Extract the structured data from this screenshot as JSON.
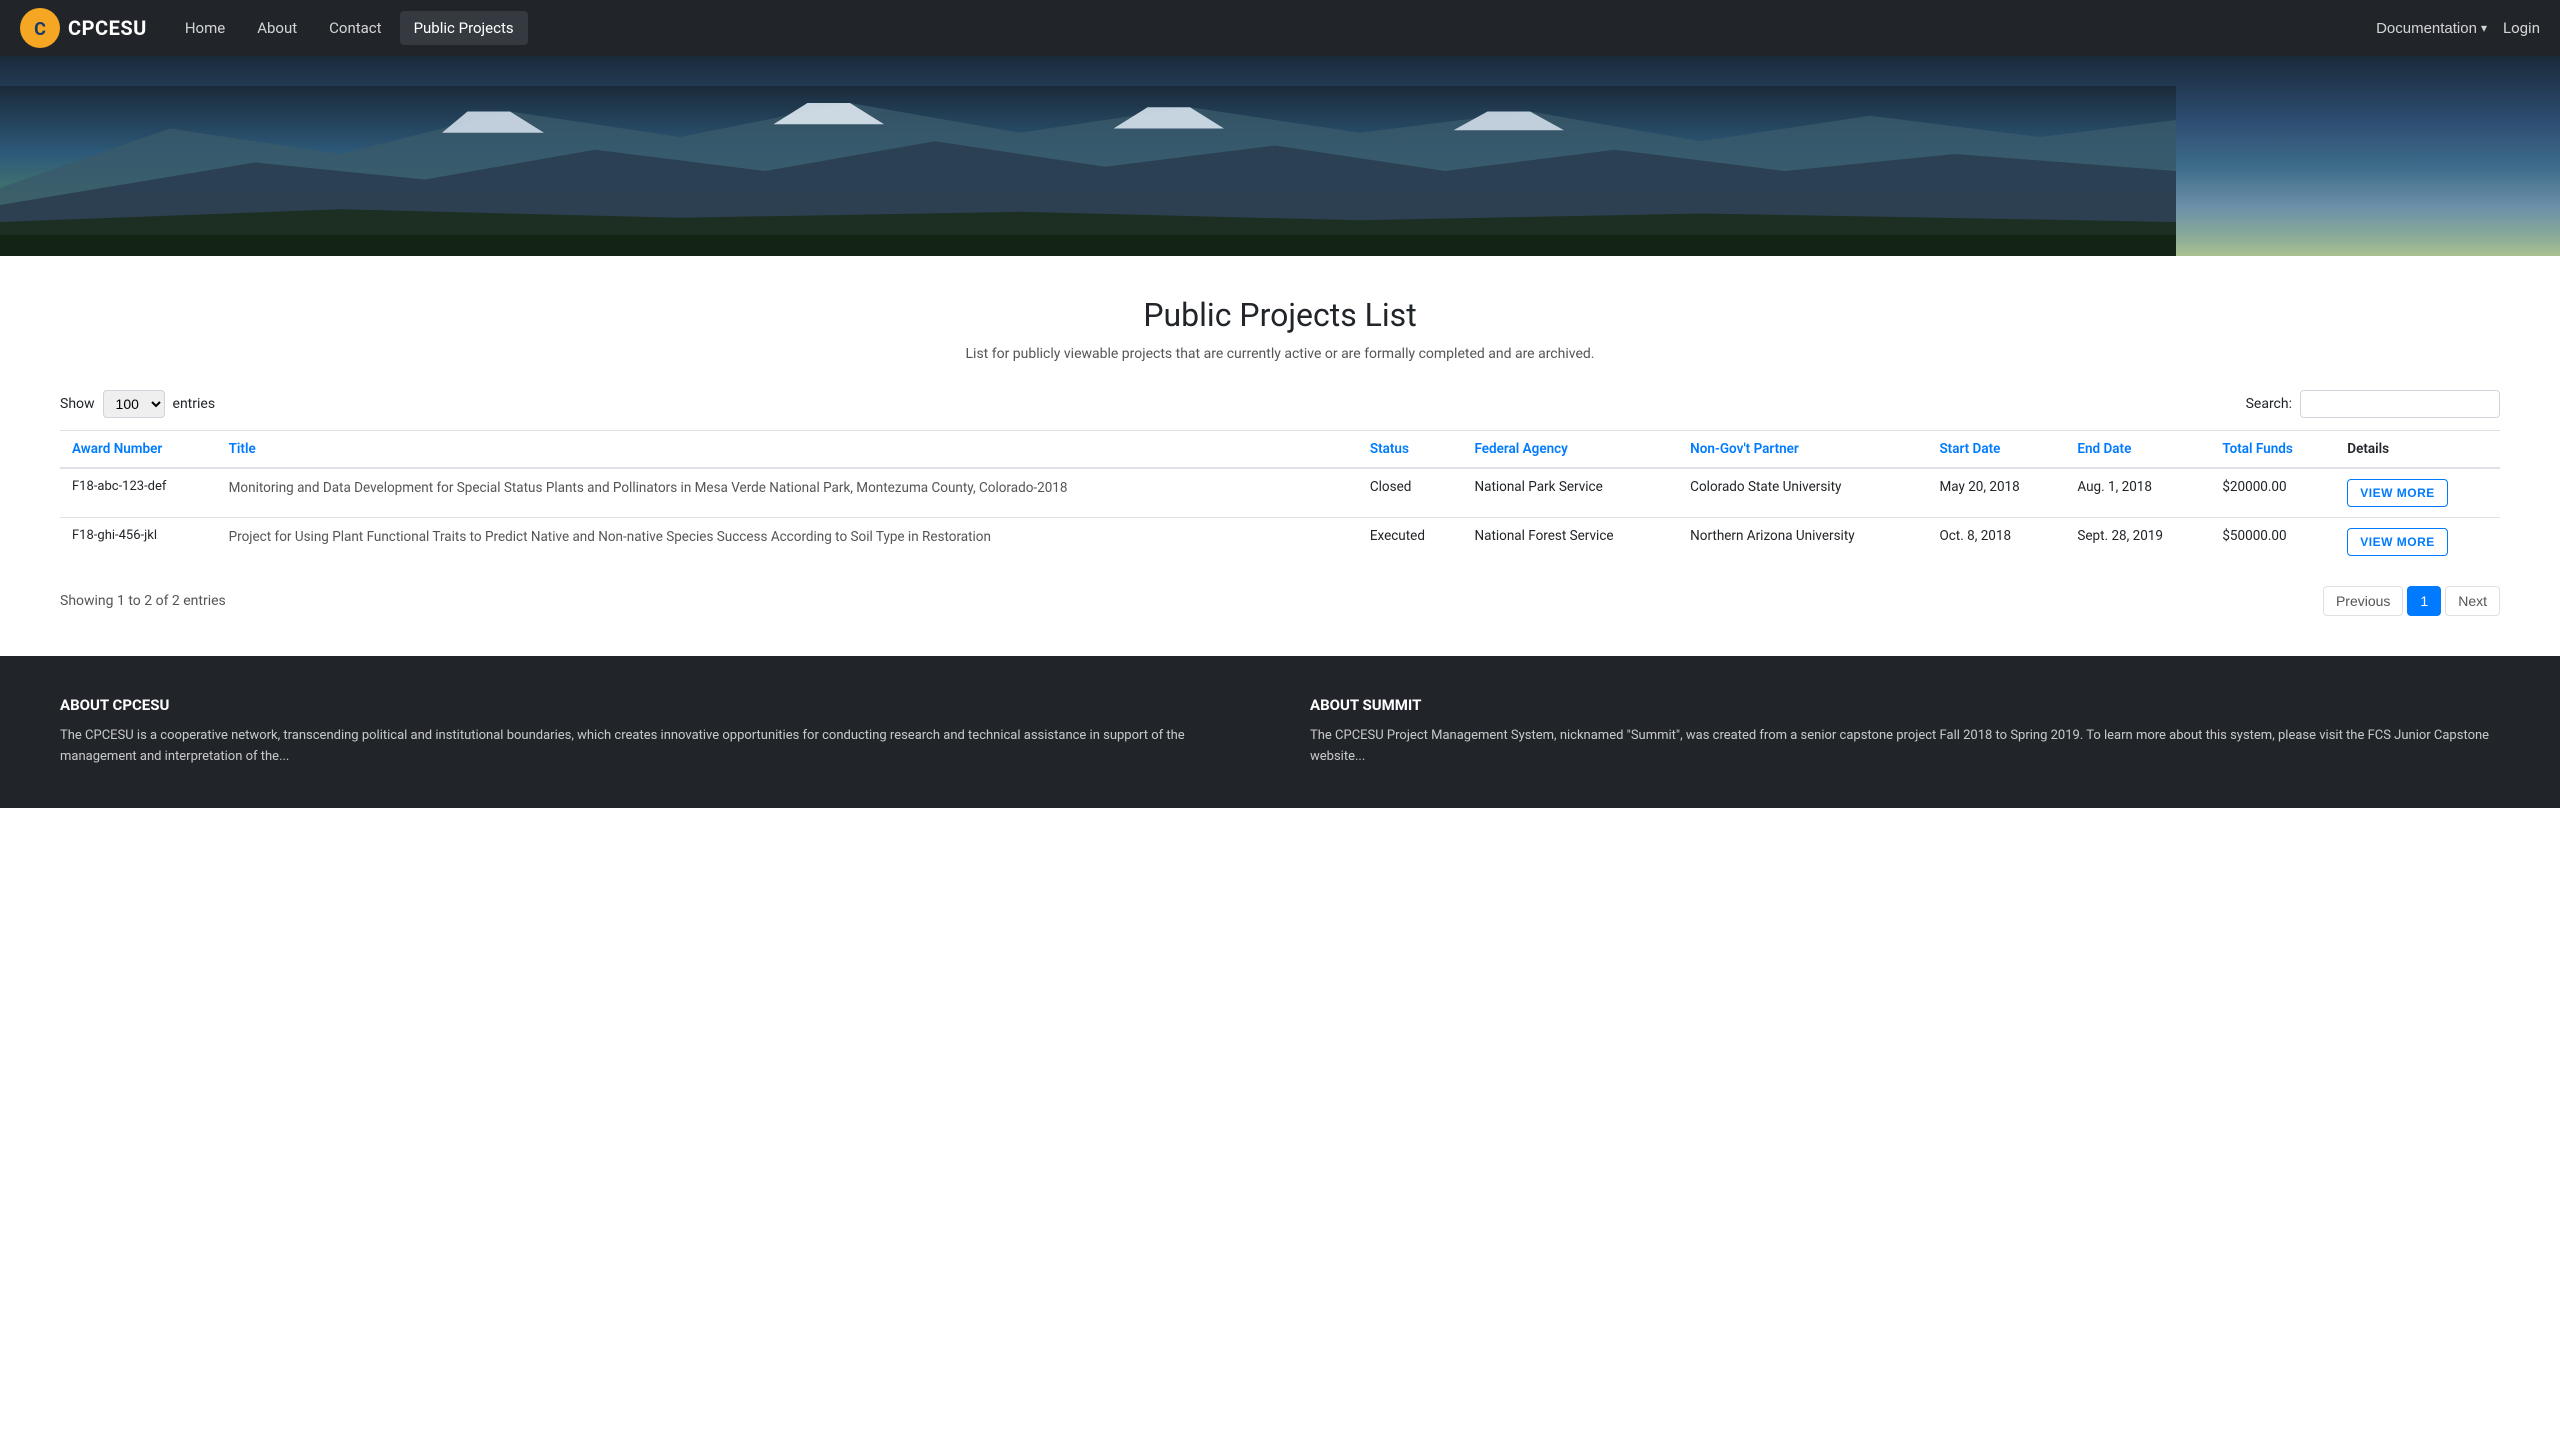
{
  "nav": {
    "brand_text": "CPCESU",
    "links": [
      {
        "label": "Home",
        "active": false
      },
      {
        "label": "About",
        "active": false
      },
      {
        "label": "Contact",
        "active": false
      },
      {
        "label": "Public Projects",
        "active": true
      }
    ],
    "doc_label": "Documentation",
    "login_label": "Login"
  },
  "page": {
    "title": "Public Projects List",
    "subtitle": "List for publicly viewable projects that are currently active or are formally completed and are archived.",
    "show_label": "Show",
    "entries_label": "entries",
    "show_value": "100",
    "search_label": "Search:"
  },
  "table": {
    "columns": [
      "Award Number",
      "Title",
      "Status",
      "Federal Agency",
      "Non-Gov't Partner",
      "Start Date",
      "End Date",
      "Total Funds",
      "Details"
    ],
    "rows": [
      {
        "award_number": "F18-abc-123-def",
        "title": "Monitoring and Data Development for Special Status Plants and Pollinators in Mesa Verde National Park, Montezuma County, Colorado-2018",
        "status": "Closed",
        "federal_agency": "National Park Service",
        "partner": "Colorado State University",
        "start_date": "May 20, 2018",
        "end_date": "Aug. 1, 2018",
        "total_funds": "$20000.00",
        "btn_label": "VIEW MORE"
      },
      {
        "award_number": "F18-ghi-456-jkl",
        "title": "Project for Using Plant Functional Traits to Predict Native and Non-native Species Success According to Soil Type in Restoration",
        "status": "Executed",
        "federal_agency": "National Forest Service",
        "partner": "Northern Arizona University",
        "start_date": "Oct. 8, 2018",
        "end_date": "Sept. 28, 2019",
        "total_funds": "$50000.00",
        "btn_label": "VIEW MORE"
      }
    ]
  },
  "pagination": {
    "showing_text": "Showing 1 to 2 of 2 entries",
    "previous_label": "Previous",
    "next_label": "Next",
    "current_page": "1"
  },
  "footer": {
    "about_cpcesu_heading": "ABOUT CPCESU",
    "about_cpcesu_text": "The CPCESU is a cooperative network, transcending political and institutional boundaries, which creates innovative opportunities for conducting research and technical assistance in support of the management and interpretation of the...",
    "about_summit_heading": "ABOUT SUMMIT",
    "about_summit_text": "The CPCESU Project Management System, nicknamed \"Summit\", was created from a senior capstone project Fall 2018 to Spring 2019. To learn more about this system, please visit the FCS Junior Capstone website..."
  }
}
